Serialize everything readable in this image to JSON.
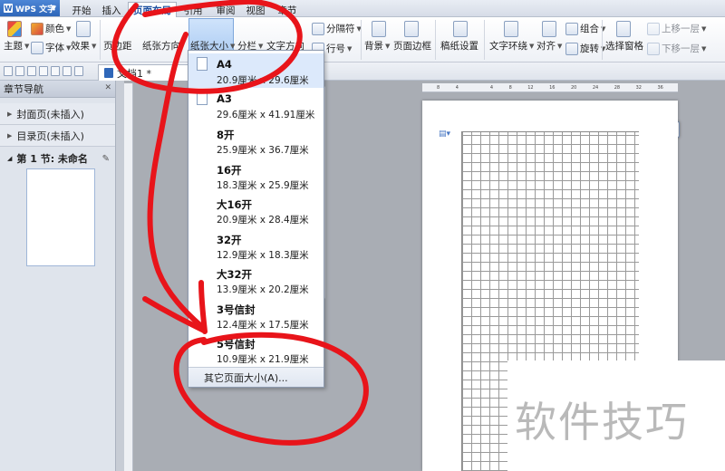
{
  "app": {
    "name": "WPS 文字",
    "logo_letter": "W"
  },
  "tabs": [
    {
      "label": "开始"
    },
    {
      "label": "插入"
    },
    {
      "label": "页面布局"
    },
    {
      "label": "引用"
    },
    {
      "label": "审阅"
    },
    {
      "label": "视图"
    },
    {
      "label": "章节"
    }
  ],
  "ribbon": {
    "theme": "主题",
    "color": "颜色",
    "font": "字体",
    "effect": "效果",
    "margins": "页边距",
    "orientation": "纸张方向",
    "paper_size": "纸张大小",
    "columns": "分栏",
    "text_direction": "文字方向",
    "separator": "分隔符",
    "line_number": "行号",
    "background": "背景",
    "page_border": "页面边框",
    "draft_paper": "稿纸设置",
    "text_wrap": "文字环绕",
    "align": "对齐",
    "group": "组合",
    "rotate": "旋转",
    "selection_pane": "选择窗格",
    "bring_forward": "上移一层",
    "send_backward": "下移一层"
  },
  "doc_tab": {
    "label": "文档1 *"
  },
  "nav": {
    "title": "章节导航",
    "items": [
      {
        "label": "封面页(未插入)"
      },
      {
        "label": "目录页(未插入)"
      }
    ],
    "section": {
      "label": "第 1 节: 未命名"
    }
  },
  "ruler": {
    "ticks": [
      "8",
      "4",
      "",
      "4",
      "8",
      "12",
      "16",
      "20",
      "24",
      "28",
      "32",
      "36"
    ]
  },
  "paper_menu": {
    "items": [
      {
        "name": "A4",
        "dims": "20.9厘米 x 29.6厘米"
      },
      {
        "name": "A3",
        "dims": "29.6厘米 x 41.91厘米"
      },
      {
        "name": "8开",
        "dims": "25.9厘米 x 36.7厘米"
      },
      {
        "name": "16开",
        "dims": "18.3厘米 x 25.9厘米"
      },
      {
        "name": "大16开",
        "dims": "20.9厘米 x 28.4厘米"
      },
      {
        "name": "32开",
        "dims": "12.9厘米 x 18.3厘米"
      },
      {
        "name": "大32开",
        "dims": "13.9厘米 x 20.2厘米"
      },
      {
        "name": "3号信封",
        "dims": "12.4厘米 x 17.5厘米"
      },
      {
        "name": "5号信封",
        "dims": "10.9厘米 x 21.9厘米"
      }
    ],
    "footer": "其它页面大小(A)..."
  },
  "watermark": {
    "text": "软件技巧"
  },
  "colors": {
    "accent": "#2f67b9",
    "annotation": "#e8141a",
    "menu_highlight": "#dce9fb"
  }
}
